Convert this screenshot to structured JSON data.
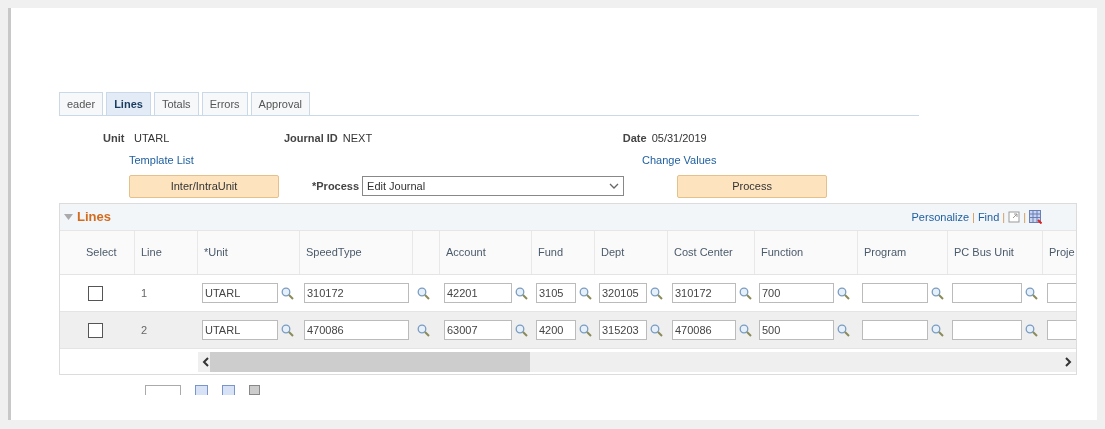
{
  "tabs": [
    {
      "label": "eader",
      "selected": false
    },
    {
      "label": "Lines",
      "selected": true
    },
    {
      "label": "Totals",
      "selected": false
    },
    {
      "label": "Errors",
      "selected": false
    },
    {
      "label": "Approval",
      "selected": false
    }
  ],
  "header": {
    "unit_label": "Unit",
    "unit": "UTARL",
    "journal_label": "Journal ID",
    "journal_id": "NEXT",
    "date_label": "Date",
    "date": "05/31/2019",
    "template_link": "Template List",
    "change_link": "Change Values",
    "interunit_button": "Inter/IntraUnit",
    "process_label": "*Process",
    "process_value": "Edit Journal",
    "process_button": "Process"
  },
  "grid": {
    "title": "Lines",
    "personalize": "Personalize",
    "find": "Find",
    "separator": "|",
    "columns": [
      "Select",
      "Line",
      "*Unit",
      "SpeedType",
      "Account",
      "Fund",
      "Dept",
      "Cost Center",
      "Function",
      "Program",
      "PC Bus Unit",
      "Proje"
    ],
    "rows": [
      {
        "checked": false,
        "line": "1",
        "fields": [
          {
            "value": "UTARL"
          },
          {
            "value": "310172"
          },
          {
            "value": "42201"
          },
          {
            "value": "3105"
          },
          {
            "value": "320105"
          },
          {
            "value": "310172"
          },
          {
            "value": "700"
          }
        ]
      },
      {
        "checked": false,
        "line": "2",
        "fields": [
          {
            "value": "UTARL"
          },
          {
            "value": "470086"
          },
          {
            "value": "63007"
          },
          {
            "value": "4200"
          },
          {
            "value": "315203"
          },
          {
            "value": "470086"
          },
          {
            "value": "500"
          }
        ]
      }
    ]
  }
}
